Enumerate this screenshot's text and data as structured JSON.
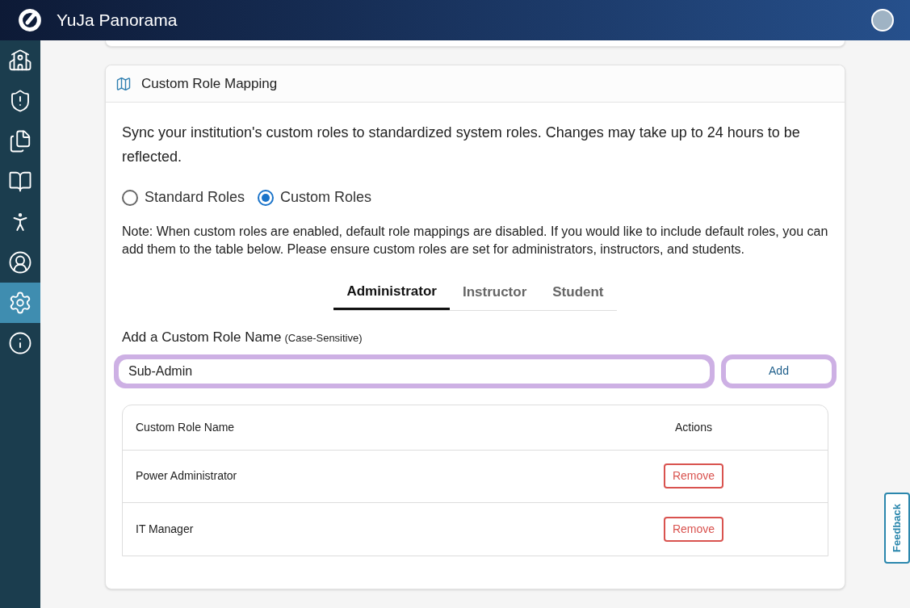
{
  "header": {
    "title": "YuJa Panorama"
  },
  "sidebar": {
    "items": [
      {
        "kind": "school",
        "selected": false
      },
      {
        "kind": "shield",
        "selected": false
      },
      {
        "kind": "documents",
        "selected": false
      },
      {
        "kind": "book",
        "selected": false
      },
      {
        "kind": "accessibility",
        "selected": false
      },
      {
        "kind": "user",
        "selected": false
      },
      {
        "kind": "settings",
        "selected": true
      },
      {
        "kind": "info",
        "selected": false
      }
    ]
  },
  "card": {
    "title": "Custom Role Mapping",
    "description": "Sync your institution's custom roles to standardized system roles. Changes may take up to 24 hours to be reflected.",
    "role_options": [
      {
        "label": "Standard Roles",
        "selected": false
      },
      {
        "label": "Custom Roles",
        "selected": true
      }
    ],
    "note": "Note: When custom roles are enabled, default role mappings are disabled. If you would like to include default roles, you can add them to the table below. Please ensure custom roles are set for administrators, instructors, and students.",
    "tabs": [
      {
        "label": "Administrator",
        "selected": true
      },
      {
        "label": "Instructor",
        "selected": false
      },
      {
        "label": "Student",
        "selected": false
      }
    ],
    "field_label": "Add a Custom Role Name",
    "field_hint": "(Case-Sensitive)",
    "field_value": "Sub-Admin",
    "add_button": "Add",
    "table": {
      "columns": [
        "Custom Role Name",
        "Actions"
      ],
      "rows": [
        {
          "name": "Power Administrator",
          "action": "Remove"
        },
        {
          "name": "IT Manager",
          "action": "Remove"
        }
      ]
    }
  },
  "feedback": "Feedback"
}
